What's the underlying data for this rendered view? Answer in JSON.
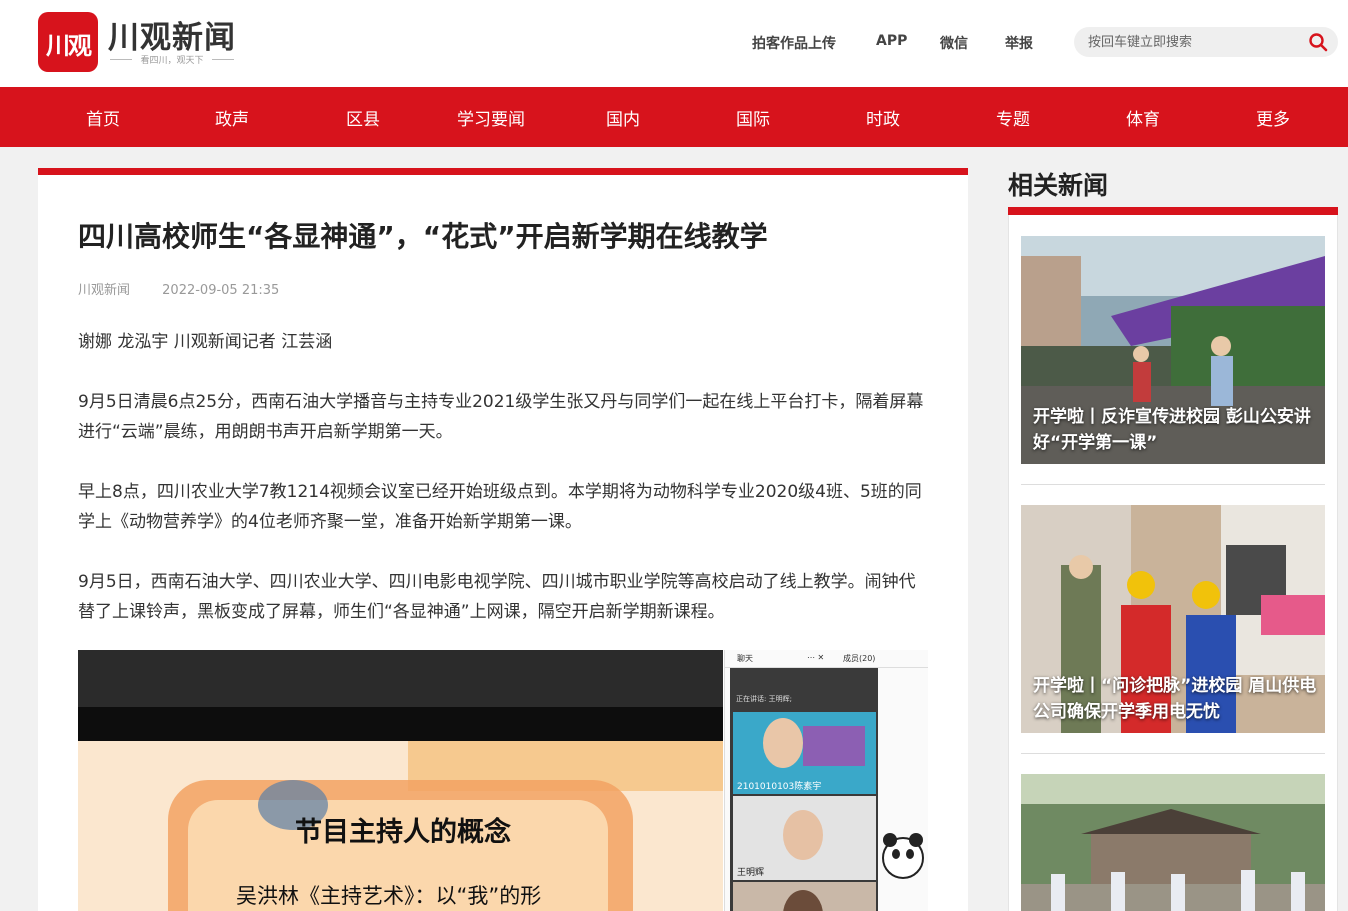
{
  "header": {
    "logo_mark": "川观",
    "logo_text": "川观新闻",
    "logo_slogan": "看四川，观天下",
    "links": [
      "拍客作品上传",
      "APP",
      "微信",
      "举报"
    ],
    "search_placeholder": "按回车键立即搜索"
  },
  "nav": [
    "首页",
    "政声",
    "区县",
    "学习要闻",
    "国内",
    "国际",
    "时政",
    "专题",
    "体育",
    "更多"
  ],
  "article": {
    "title": "四川高校师生“各显神通”，“花式”开启新学期在线教学",
    "source": "川观新闻",
    "date": "2022-09-05 21:35",
    "paragraphs": [
      "谢娜 龙泓宇 川观新闻记者 江芸涵",
      "9月5日清晨6点25分，西南石油大学播音与主持专业2021级学生张又丹与同学们一起在线上平台打卡，隔着屏幕进行“云端”晨练，用朗朗书声开启新学期第一天。",
      "早上8点，四川农业大学7教1214视频会议室已经开始班级点到。本学期将为动物科学专业2020级4班、5班的同学上《动物营养学》的4位老师齐聚一堂，准备开始新学期第一课。",
      "9月5日，西南石油大学、四川农业大学、四川电影电视学院、四川城市职业学院等高校启动了线上教学。闹钟代替了上课铃声，黑板变成了屏幕，师生们“各显神通”上网课，隔空开启新学期新课程。"
    ],
    "image": {
      "slide_title": "节目主持人的概念",
      "slide_text": "吴洪林《主持艺术》：以“我”的形",
      "panel_chat": "聊天",
      "panel_members": "成员(20)",
      "speaking": "正在讲话: 王明辉;",
      "tile1_name": "2101010103陈素宇",
      "tile2_name": "王明辉"
    }
  },
  "sidebar": {
    "title": "相关新闻",
    "items": [
      {
        "caption": "开学啦丨反诈宣传进校园 彭山公安讲好“开学第一课”"
      },
      {
        "caption": "开学啦丨“问诊把脉”进校园 眉山供电公司确保开学季用电无忧"
      },
      {
        "caption": ""
      }
    ]
  }
}
